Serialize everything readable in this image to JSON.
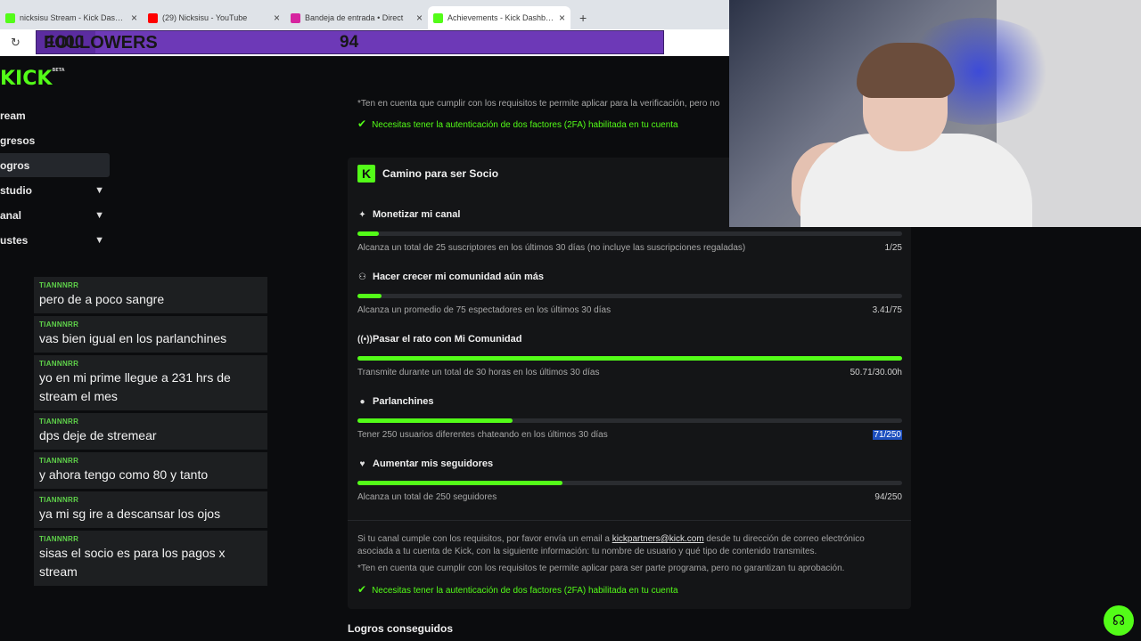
{
  "browser": {
    "tabs": [
      {
        "title": "nicksisu Stream - Kick Dashboard",
        "favicon_color": "#53fc18",
        "active": false
      },
      {
        "title": "(29) Nicksisu - YouTube",
        "favicon_color": "#ff0000",
        "active": false
      },
      {
        "title": "Bandeja de entrada • Direct",
        "favicon_color": "#d6249f",
        "active": false
      },
      {
        "title": "Achievements - Kick Dashboard",
        "favicon_color": "#53fc18",
        "active": true
      }
    ],
    "new_tab": "+",
    "reload_icon": "reload-icon"
  },
  "overlay": {
    "label": "FOLLOWERS",
    "count": "94",
    "goal": "1000",
    "progress_fraction": 0.094
  },
  "sidebar": {
    "logo": "KICK",
    "logo_sup": "BETA",
    "items": [
      {
        "label": "ream",
        "chevron": false,
        "active": false
      },
      {
        "label": "gresos",
        "chevron": false,
        "active": false
      },
      {
        "label": "ogros",
        "chevron": false,
        "active": true
      },
      {
        "label": "studio",
        "chevron": true,
        "active": false
      },
      {
        "label": "anal",
        "chevron": true,
        "active": false
      },
      {
        "label": "ustes",
        "chevron": true,
        "active": false
      }
    ]
  },
  "chat": [
    {
      "user": "TIANNNRR",
      "text": "pero de a poco sangre"
    },
    {
      "user": "TIANNNRR",
      "text": "vas bien igual en los parlanchines"
    },
    {
      "user": "TIANNNRR",
      "text": "yo en mi prime llegue a 231 hrs de stream el mes"
    },
    {
      "user": "TIANNNRR",
      "text": "dps deje de stremear"
    },
    {
      "user": "TIANNNRR",
      "text": "y ahora tengo como 80 y tanto"
    },
    {
      "user": "TIANNNRR",
      "text": "ya mi sg ire a descansar los ojos"
    },
    {
      "user": "TIANNNRR",
      "text": "sisas el socio es para los pagos x stream"
    }
  ],
  "verification": {
    "note": "*Ten en cuenta que cumplir con los requisitos te permite aplicar para la verificación, pero no",
    "requirement": "Necesitas tener la autenticación de dos factores (2FA) habilitada en tu cuenta"
  },
  "partner": {
    "badge": "K",
    "title": "Camino para ser Socio",
    "goals": [
      {
        "icon": "✦",
        "icon_name": "sparkle-icon",
        "title": "Monetizar mi canal",
        "desc": "Alcanza un total de 25 suscriptores en los últimos 30 días (no incluye las suscripciones regaladas)",
        "progress": "1/25",
        "fraction": 0.04,
        "highlight": false
      },
      {
        "icon": "⚇",
        "icon_name": "community-icon",
        "title": "Hacer crecer mi comunidad aún más",
        "desc": "Alcanza un promedio de 75 espectadores en los últimos 30 días",
        "progress": "3.41/75",
        "fraction": 0.045,
        "highlight": false
      },
      {
        "icon": "((•))",
        "icon_name": "broadcast-icon",
        "title": "Pasar el rato con Mi Comunidad",
        "desc": "Transmite durante un total de 30 horas en los últimos 30 días",
        "progress": "50.71/30.00h",
        "fraction": 1.0,
        "highlight": false
      },
      {
        "icon": "●",
        "icon_name": "chat-bubble-icon",
        "title": "Parlanchines",
        "desc": "Tener 250 usuarios diferentes chateando en los últimos 30 días",
        "progress": "71/250",
        "fraction": 0.284,
        "highlight": true
      },
      {
        "icon": "♥",
        "icon_name": "heart-icon",
        "title": "Aumentar mis seguidores",
        "desc": "Alcanza un total de 250 seguidores",
        "progress": "94/250",
        "fraction": 0.376,
        "highlight": false
      }
    ],
    "footer": {
      "line1_pre": "Si tu canal cumple con los requisitos, por favor envía un email a ",
      "email": "kickpartners@kick.com",
      "line1_post": " desde tu dirección de correo electrónico asociada a tu cuenta de Kick, con la siguiente información: tu nombre de usuario y qué tipo de contenido transmites.",
      "note": "*Ten en cuenta que cumplir con los requisitos te permite aplicar para ser parte programa, pero no garantizan tu aprobación.",
      "requirement": "Necesitas tener la autenticación de dos factores (2FA) habilitada en tu cuenta"
    }
  },
  "achievements_heading": "Logros conseguidos",
  "colors": {
    "accent": "#53fc18",
    "overlay": "#6d39b7",
    "background": "#0b0c0e"
  }
}
